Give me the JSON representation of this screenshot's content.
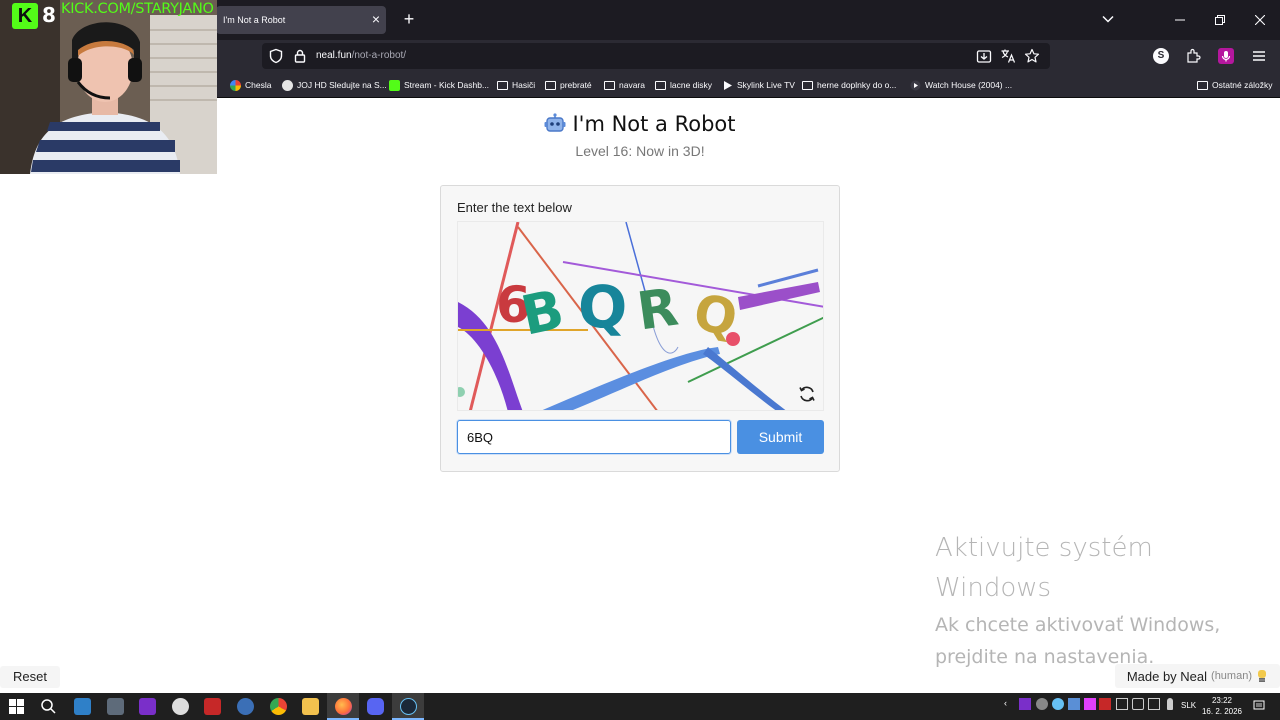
{
  "stream": {
    "platform_letter": "K",
    "viewer_count": "8",
    "channel_url": "KICK.COM/STARYJANO"
  },
  "browser": {
    "tab_title": "I'm Not a Robot",
    "url_domain": "neal.fun",
    "url_path": "/not-a-robot/",
    "bookmarks": [
      {
        "label": "Chesla",
        "icon": "google-icon"
      },
      {
        "label": "JOJ HD Sledujte na S...",
        "icon": "joj-icon"
      },
      {
        "label": "Stream - Kick Dashb...",
        "icon": "kick-icon"
      },
      {
        "label": "Hasiči",
        "icon": "folder-icon"
      },
      {
        "label": "prebraté",
        "icon": "folder-icon"
      },
      {
        "label": "navara",
        "icon": "folder-icon"
      },
      {
        "label": "lacne disky",
        "icon": "folder-icon"
      },
      {
        "label": "Skylink Live TV",
        "icon": "play-icon"
      },
      {
        "label": "herne doplnky do o...",
        "icon": "folder-icon"
      },
      {
        "label": "Watch House (2004) ...",
        "icon": "play-circle-icon"
      }
    ],
    "other_bookmarks": "Ostatné záložky"
  },
  "page": {
    "title": "I'm Not a Robot",
    "subtitle": "Level 16: Now in 3D!",
    "prompt": "Enter the text below",
    "captcha_text": "6BQRQ",
    "answer_value": "6BQ",
    "submit_label": "Submit",
    "reset_label": "Reset",
    "made_by": "Made by Neal",
    "made_by_note": "(human)"
  },
  "watermark": {
    "line1": "Aktivujte systém",
    "line2": "Windows",
    "line3": "Ak chcete aktivovať Windows,",
    "line4": "prejdite na nastavenia."
  },
  "taskbar": {
    "language": "SLK",
    "time": "23:22",
    "date": "16. 2. 2026"
  },
  "colors": {
    "accent": "#4a90e2",
    "kick_green": "#53fc18"
  }
}
